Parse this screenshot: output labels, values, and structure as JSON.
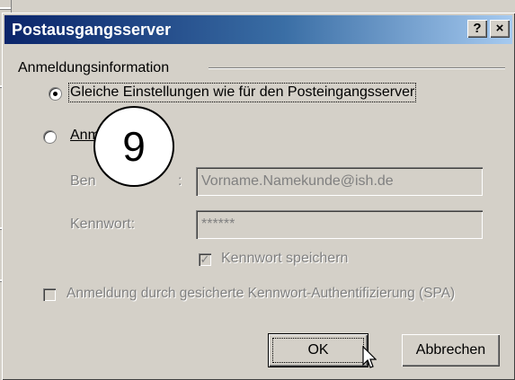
{
  "window": {
    "title": "Postausgangsserver",
    "help_glyph": "?",
    "close_glyph": "×"
  },
  "group": {
    "label": "Anmeldungsinformation"
  },
  "options": {
    "same_settings_label": "Gleiche Einstellungen wie für den Posteingangsserver",
    "same_settings_selected": true,
    "login_label_visible": "Anm",
    "login_selected": false
  },
  "fields": {
    "username_label_visible": "Ben",
    "username_label_tail": ":",
    "username_value": "Vorname.Namekunde@ish.de",
    "password_label": "Kennwort:",
    "password_value": "******"
  },
  "save_password": {
    "label": "Kennwort speichern",
    "checked": true
  },
  "spa": {
    "label": "Anmeldung durch gesicherte Kennwort-Authentifizierung (SPA)",
    "checked": false
  },
  "buttons": {
    "ok": "OK",
    "cancel": "Abbrechen"
  },
  "step_badge": {
    "number": "9"
  }
}
